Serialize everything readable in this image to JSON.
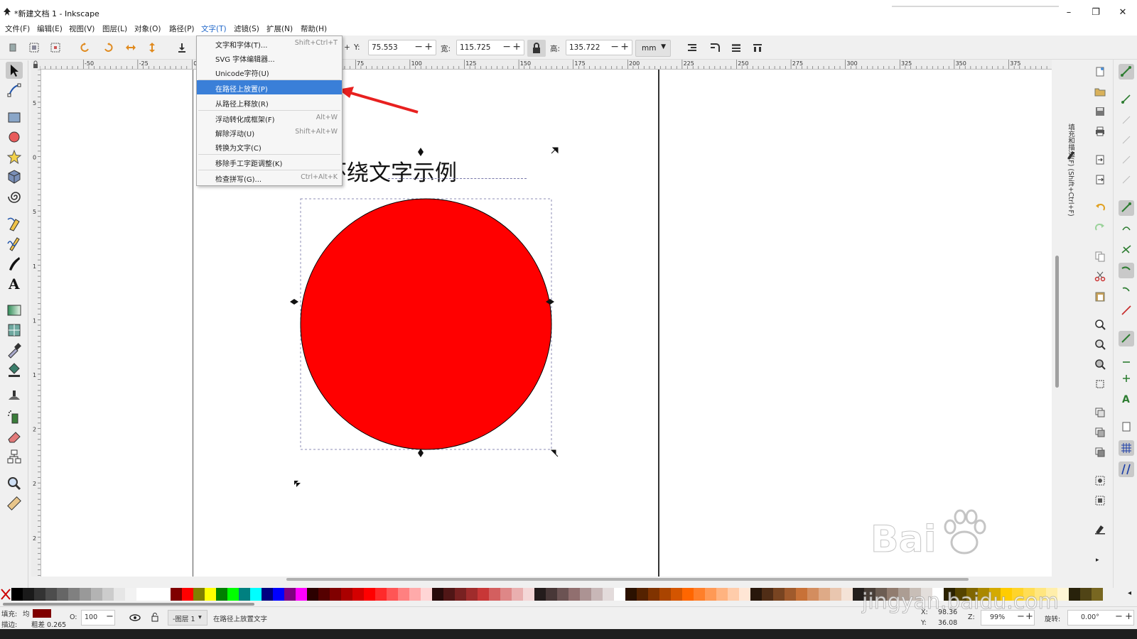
{
  "window": {
    "title": "*新建文档 1 - Inkscape",
    "controls": [
      "–",
      "❐",
      "✕"
    ]
  },
  "menubar": [
    "文件(F)",
    "编辑(E)",
    "视图(V)",
    "图层(L)",
    "对象(O)",
    "路径(P)",
    "文字(T)",
    "滤镜(S)",
    "扩展(N)",
    "帮助(H)"
  ],
  "menubar_active": "文字(T)",
  "toolbar": {
    "x_value": "",
    "y_label": "Y:",
    "y_value": "75.553",
    "w_label": "宽:",
    "w_value": "115.725",
    "h_label": "高:",
    "h_value": "135.722",
    "unit": "mm"
  },
  "text_menu": {
    "items": [
      {
        "label": "文字和字体(T)...",
        "shortcut": "Shift+Ctrl+T"
      },
      {
        "label": "SVG 字体编辑器...",
        "shortcut": ""
      },
      {
        "label": "Unicode字符(U)",
        "shortcut": ""
      },
      {
        "label": "在路径上放置(P)",
        "shortcut": "",
        "highlighted": true
      },
      {
        "label": "从路径上释放(R)",
        "shortcut": ""
      },
      {
        "label": "浮动转化成框架(F)",
        "shortcut": "Alt+W"
      },
      {
        "label": "解除浮动(U)",
        "shortcut": "Shift+Alt+W"
      },
      {
        "label": "转换为文字(C)",
        "shortcut": ""
      },
      {
        "label": "移除手工字距调整(K)",
        "shortcut": ""
      },
      {
        "label": "检查拼写(G)...",
        "shortcut": "Ctrl+Alt+K"
      }
    ]
  },
  "canvas": {
    "text_object": "环绕文字示例",
    "circle_fill": "#ff0000",
    "circle_stroke": "#000000"
  },
  "ruler_h_labels": [
    "-50",
    "-25",
    "0",
    "25",
    "50",
    "75",
    "100",
    "125",
    "150",
    "175",
    "200",
    "225",
    "250",
    "275",
    "300",
    "325",
    "350",
    "375"
  ],
  "ruler_v_labels": [
    "5",
    "0",
    "5",
    "1",
    "1",
    "1",
    "2",
    "2",
    "2",
    "3"
  ],
  "dock_tab_label": "填充和描边(F) (Shift+Ctrl+F)",
  "statusbar": {
    "fill_label": "填充:",
    "fill_mode": "均",
    "fill_color": "#7f0000",
    "stroke_label": "描边:",
    "stroke_width": "粗差 0.265",
    "opacity_label": "O:",
    "opacity_value": "100",
    "layer": "-图层 1",
    "message": "在路径上放置文字",
    "x_label": "X:",
    "x_value": "98.36",
    "y_label": "Y:",
    "y_value": "36.08",
    "zoom_label": "Z:",
    "zoom_value": "99%",
    "rotate_label": "旋转:",
    "rotate_value": "0.00°"
  },
  "palette": [
    "#000000",
    "#1a1a1a",
    "#333333",
    "#4d4d4d",
    "#666666",
    "#808080",
    "#999999",
    "#b3b3b3",
    "#cccccc",
    "#e6e6e6",
    "#f2f2f2",
    "#ffffff",
    "#ffffff",
    "#ffffff",
    "#800000",
    "#ff0000",
    "#808000",
    "#ffff00",
    "#008000",
    "#00ff00",
    "#008080",
    "#00ffff",
    "#000080",
    "#0000ff",
    "#800080",
    "#ff00ff",
    "#2b0000",
    "#550000",
    "#800000",
    "#aa0000",
    "#d40000",
    "#ff0000",
    "#ff2a2a",
    "#ff5555",
    "#ff8080",
    "#ffaaaa",
    "#ffd5d5",
    "#280b0b",
    "#501616",
    "#782121",
    "#a02c2c",
    "#c83737",
    "#d35f5f",
    "#de8787",
    "#e9afaf",
    "#f4d7d7",
    "#241c1c",
    "#483737",
    "#6c5353",
    "#916f6f",
    "#ac9393",
    "#c8b7b7",
    "#e3dbdb",
    "#ffffff",
    "#2b1100",
    "#552200",
    "#803300",
    "#aa4400",
    "#d45500",
    "#ff6600",
    "#ff7f2a",
    "#ff9955",
    "#ffb380",
    "#ffccaa",
    "#ffe6d5",
    "#28170b",
    "#502d16",
    "#784421",
    "#a05a2c",
    "#c87137",
    "#d38d5f",
    "#deaa87",
    "#e9c6af",
    "#f4e3d7",
    "#241f1c",
    "#483e37",
    "#6c5d53",
    "#917c6f",
    "#ac9d93",
    "#c8beb7",
    "#e3dedb",
    "#ffffff",
    "#2b2200",
    "#554400",
    "#806600",
    "#aa8800",
    "#d4aa00",
    "#ffcc00",
    "#ffd42a",
    "#ffdd55",
    "#ffe680",
    "#ffeeaa",
    "#fff6d5",
    "#28220b",
    "#504416",
    "#786721"
  ],
  "watermark": {
    "brand": "Bai",
    "domain": "jingyan.baidu.com"
  }
}
